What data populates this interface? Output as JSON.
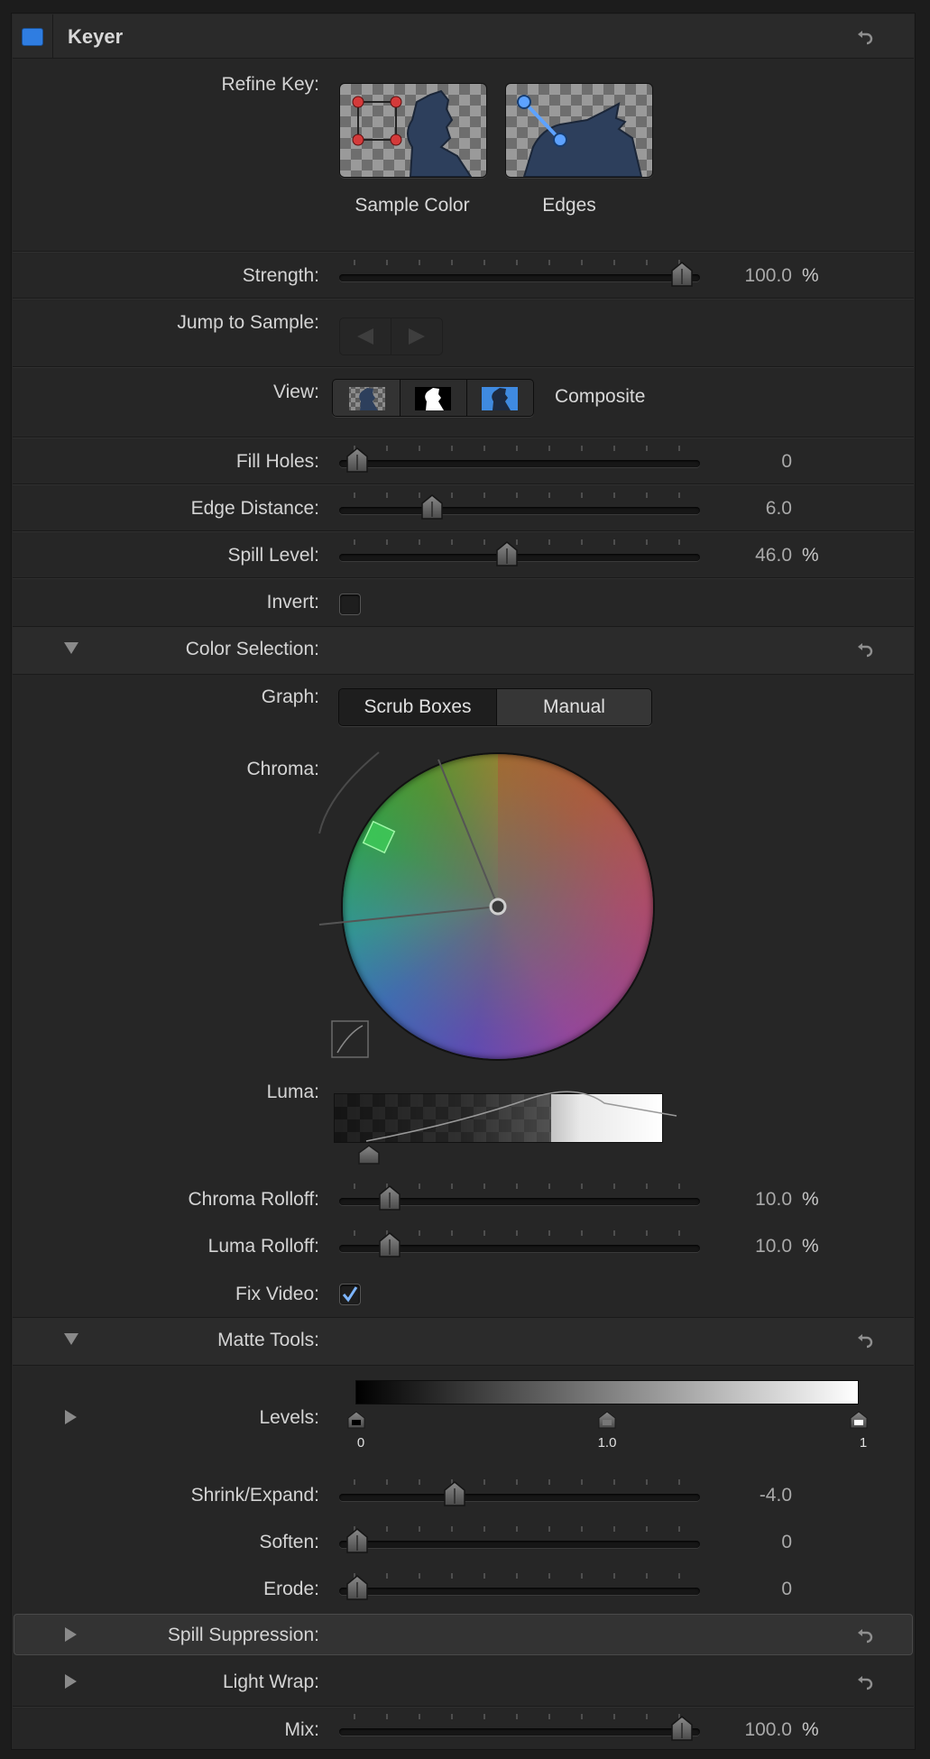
{
  "header": {
    "title": "Keyer",
    "accent": "#2f7de1"
  },
  "refine_key": {
    "label": "Refine Key:",
    "buttons": [
      {
        "label": "Sample Color",
        "icon": "sample-color-icon"
      },
      {
        "label": "Edges",
        "icon": "edges-icon"
      }
    ]
  },
  "strength": {
    "label": "Strength:",
    "value": "100.0",
    "unit": "%",
    "level": 1.0
  },
  "jump_to_sample": {
    "label": "Jump to Sample:",
    "prev_icon": "triangle-left-icon",
    "next_icon": "triangle-right-icon"
  },
  "view": {
    "label": "View:",
    "options": [
      "composite-checker-icon",
      "matte-icon",
      "original-icon"
    ],
    "selected_label": "Composite"
  },
  "fill_holes": {
    "label": "Fill Holes:",
    "value": "0",
    "level": 0.0
  },
  "edge_distance": {
    "label": "Edge Distance:",
    "value": "6.0",
    "level": 0.23
  },
  "spill_level": {
    "label": "Spill Level:",
    "value": "46.0",
    "unit": "%",
    "level": 0.46
  },
  "invert": {
    "label": "Invert:",
    "checked": false
  },
  "color_selection": {
    "label": "Color Selection:",
    "graph": {
      "label": "Graph:",
      "options": [
        "Scrub Boxes",
        "Manual"
      ],
      "selected": "Scrub Boxes"
    },
    "chroma": {
      "label": "Chroma:"
    },
    "luma": {
      "label": "Luma:"
    },
    "chroma_rolloff": {
      "label": "Chroma Rolloff:",
      "value": "10.0",
      "unit": "%",
      "level": 0.1
    },
    "luma_rolloff": {
      "label": "Luma Rolloff:",
      "value": "10.0",
      "unit": "%",
      "level": 0.1
    },
    "fix_video": {
      "label": "Fix Video:",
      "checked": true
    }
  },
  "matte_tools": {
    "label": "Matte Tools:",
    "levels": {
      "label": "Levels:",
      "markers": [
        "0",
        "1.0",
        "1"
      ]
    },
    "shrink_expand": {
      "label": "Shrink/Expand:",
      "value": "-4.0",
      "level": 0.3
    },
    "soften": {
      "label": "Soften:",
      "value": "0",
      "level": 0.0
    },
    "erode": {
      "label": "Erode:",
      "value": "0",
      "level": 0.0
    }
  },
  "spill_suppression": {
    "label": "Spill Suppression:"
  },
  "light_wrap": {
    "label": "Light Wrap:"
  },
  "mix": {
    "label": "Mix:",
    "value": "100.0",
    "unit": "%",
    "level": 1.0
  }
}
